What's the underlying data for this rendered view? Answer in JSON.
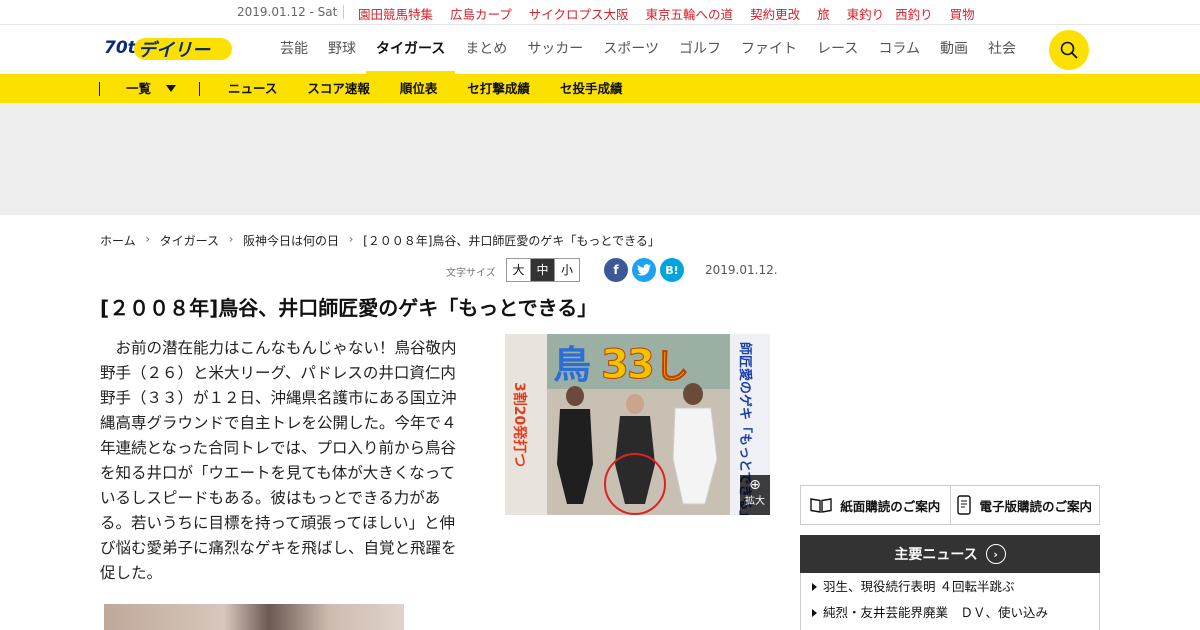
{
  "topbar": {
    "date": "2019.01.12 - Sat",
    "links": [
      "園田競馬特集",
      "広島カープ",
      "サイクロプス大阪",
      "東京五輪への道",
      "契約更改",
      "旅",
      "東釣り",
      "西釣り",
      "買物"
    ]
  },
  "header": {
    "logo_text": "デイリー",
    "logo_badge": "70th",
    "nav": [
      "芸能",
      "野球",
      "タイガース",
      "まとめ",
      "サッカー",
      "スポーツ",
      "ゴルフ",
      "ファイト",
      "レース",
      "コラム",
      "動画",
      "社会"
    ],
    "active_nav": "タイガース"
  },
  "subnav": {
    "list_label": "一覧",
    "links": [
      "ニュース",
      "スコア速報",
      "順位表",
      "セ打撃成績",
      "セ投手成績"
    ]
  },
  "breadcrumb": [
    "ホーム",
    "タイガース",
    "阪神今日は何の日",
    "[２００８年]鳥谷、井口師匠愛のゲキ「もっとできる」"
  ],
  "article": {
    "font_size_label": "文字サイズ",
    "font_sizes": [
      "大",
      "中",
      "小"
    ],
    "font_size_selected": "中",
    "share": {
      "facebook": "f",
      "twitter": "t",
      "hatena": "B!"
    },
    "date": "2019.01.12.",
    "title": "[２００８年]鳥谷、井口師匠愛のゲキ「もっとできる」",
    "body": "お前の潜在能力はこんなもんじゃない！鳥谷敬内野手（２６）と米大リーグ、パドレスの井口資仁内野手（３３）が１２日、沖縄県名護市にある国立沖縄高専グラウンドで自主トレを公開した。今年で４年連続となった合同トレでは、プロ入り前から鳥谷を知る井口が「ウエートを見ても体が大きくなっているしスピードもある。彼はもっとできる力がある。若いうちに目標を持って頑張ってほしい」と伸び悩む愛弟子に痛烈なゲキを飛ばし、自覚と飛躍を促した。",
    "photo_headline": "鳥",
    "photo_headline_2": "3",
    "photo_side": "師匠愛のゲキ「もっとできる」",
    "photo_caption": "3割20発打つ",
    "zoom_label": "拡大"
  },
  "sidebar": {
    "subscribe_paper": "紙面購読のご案内",
    "subscribe_digital": "電子版購読のご案内",
    "news_heading": "主要ニュース",
    "news_items": [
      "羽生、現役続行表明 ４回転半跳ぶ",
      "純烈・友井芸能界廃業　ＤＶ、使い込み"
    ]
  },
  "colors": {
    "accent_yellow": "#fce000",
    "link_red": "#d6202a",
    "dark_header": "#333333",
    "facebook": "#3b5998",
    "twitter": "#1da1f2",
    "hatena": "#00a4de"
  }
}
